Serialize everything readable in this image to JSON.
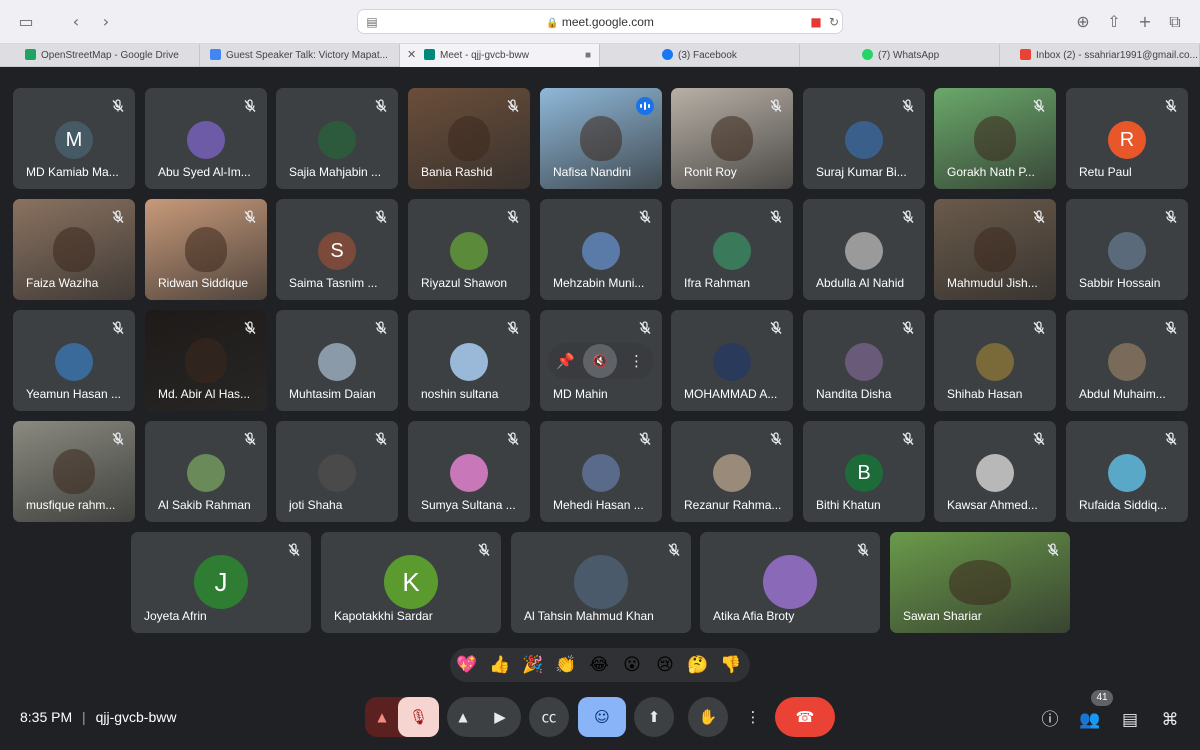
{
  "browser": {
    "url": "meet.google.com"
  },
  "tabs": [
    {
      "label": "OpenStreetMap - Google Drive",
      "color": "#1fa463"
    },
    {
      "label": "Guest Speaker Talk: Victory Mapat...",
      "color": "#4285f4"
    },
    {
      "label": "Meet - qjj-gvcb-bww",
      "color": "#00897b"
    },
    {
      "label": "(3) Facebook",
      "color": "#1877f2"
    },
    {
      "label": "(7) WhatsApp",
      "color": "#25d366"
    },
    {
      "label": "Inbox (2) - ssahriar1991@gmail.co...",
      "color": "#ea4335"
    }
  ],
  "participants": [
    {
      "name": "MD Kamiab Ma...",
      "initial": "M",
      "color": "#455a64"
    },
    {
      "name": "Abu Syed Al-Im...",
      "initial": "",
      "color": "#6d5ba8"
    },
    {
      "name": "Sajia Mahjabin ...",
      "initial": "",
      "color": "#2d5a3d"
    },
    {
      "name": "Bania Rashid",
      "initial": "",
      "color": "#6b4e3a"
    },
    {
      "name": "Nafisa Nandini",
      "initial": "",
      "color": "#8fb8d8"
    },
    {
      "name": "Ronit Roy",
      "initial": "",
      "color": "#b8b0a6"
    },
    {
      "name": "Suraj Kumar Bi...",
      "initial": "",
      "color": "#3a5f8a"
    },
    {
      "name": "Gorakh Nath P...",
      "initial": "",
      "color": "#6aa86a"
    },
    {
      "name": "Retu Paul",
      "initial": "R",
      "color": "#e8572a"
    },
    {
      "name": "Faiza Waziha",
      "initial": "",
      "color": "#8a7260"
    },
    {
      "name": "Ridwan Siddique",
      "initial": "",
      "color": "#c89a7a"
    },
    {
      "name": "Saima Tasnim ...",
      "initial": "S",
      "color": "#7b4a3a"
    },
    {
      "name": "Riyazul Shawon",
      "initial": "",
      "color": "#5a8a3a"
    },
    {
      "name": "Mehzabin Muni...",
      "initial": "",
      "color": "#5a7aa8"
    },
    {
      "name": "Ifra Rahman",
      "initial": "",
      "color": "#3a7a5a"
    },
    {
      "name": "Abdulla Al Nahid",
      "initial": "",
      "color": "#9a9a9a"
    },
    {
      "name": "Mahmudul Jish...",
      "initial": "",
      "color": "#6a5a4a"
    },
    {
      "name": "Sabbir Hossain",
      "initial": "",
      "color": "#5a6a7a"
    },
    {
      "name": "Yeamun Hasan ...",
      "initial": "",
      "color": "#3a6a9a"
    },
    {
      "name": "Md. Abir Al Has...",
      "initial": "",
      "color": "#1e1a18"
    },
    {
      "name": "Muhtasim Daian",
      "initial": "",
      "color": "#8a9aa8"
    },
    {
      "name": "noshin sultana",
      "initial": "",
      "color": "#9ab8d8"
    },
    {
      "name": "MD Mahin",
      "initial": "",
      "color": "#3c4043"
    },
    {
      "name": "MOHAMMAD A...",
      "initial": "",
      "color": "#2a3a5a"
    },
    {
      "name": "Nandita Disha",
      "initial": "",
      "color": "#6a5a7a"
    },
    {
      "name": "Shihab Hasan",
      "initial": "",
      "color": "#7a6a3a"
    },
    {
      "name": "Abdul Muhaim...",
      "initial": "",
      "color": "#7a6a5a"
    },
    {
      "name": "musfique rahm...",
      "initial": "",
      "color": "#8a8a80"
    },
    {
      "name": "Al Sakib Rahman",
      "initial": "",
      "color": "#6a8a5a"
    },
    {
      "name": "joti Shaha",
      "initial": "",
      "color": "#4a4a4a"
    },
    {
      "name": "Sumya Sultana ...",
      "initial": "",
      "color": "#c878b8"
    },
    {
      "name": "Mehedi Hasan ...",
      "initial": "",
      "color": "#5a6a8a"
    },
    {
      "name": "Rezanur Rahma...",
      "initial": "",
      "color": "#9a8a7a"
    },
    {
      "name": "Bithi Khatun",
      "initial": "B",
      "color": "#1e6b3a"
    },
    {
      "name": "Kawsar Ahmed...",
      "initial": "",
      "color": "#b8b8b8"
    },
    {
      "name": "Rufaida Siddiq...",
      "initial": "",
      "color": "#5aa8c8"
    },
    {
      "name": "Joyeta Afrin",
      "initial": "J",
      "color": "#2e7d32"
    },
    {
      "name": "Kapotakkhi Sardar",
      "initial": "K",
      "color": "#5b9a2e"
    },
    {
      "name": "Al Tahsin Mahmud Khan",
      "initial": "",
      "color": "#4a5a6a"
    },
    {
      "name": "Atika Afia Broty",
      "initial": "",
      "color": "#8a6ab8"
    },
    {
      "name": "Sawan Shariar",
      "initial": "",
      "color": "#6a9a4a"
    }
  ],
  "reactions": [
    "💖",
    "👍",
    "🎉",
    "👏",
    "😂",
    "😮",
    "😢",
    "🤔",
    "👎"
  ],
  "meeting": {
    "time": "8:35 PM",
    "separator": "|",
    "code": "qjj-gvcb-bww",
    "people_count": "41"
  }
}
